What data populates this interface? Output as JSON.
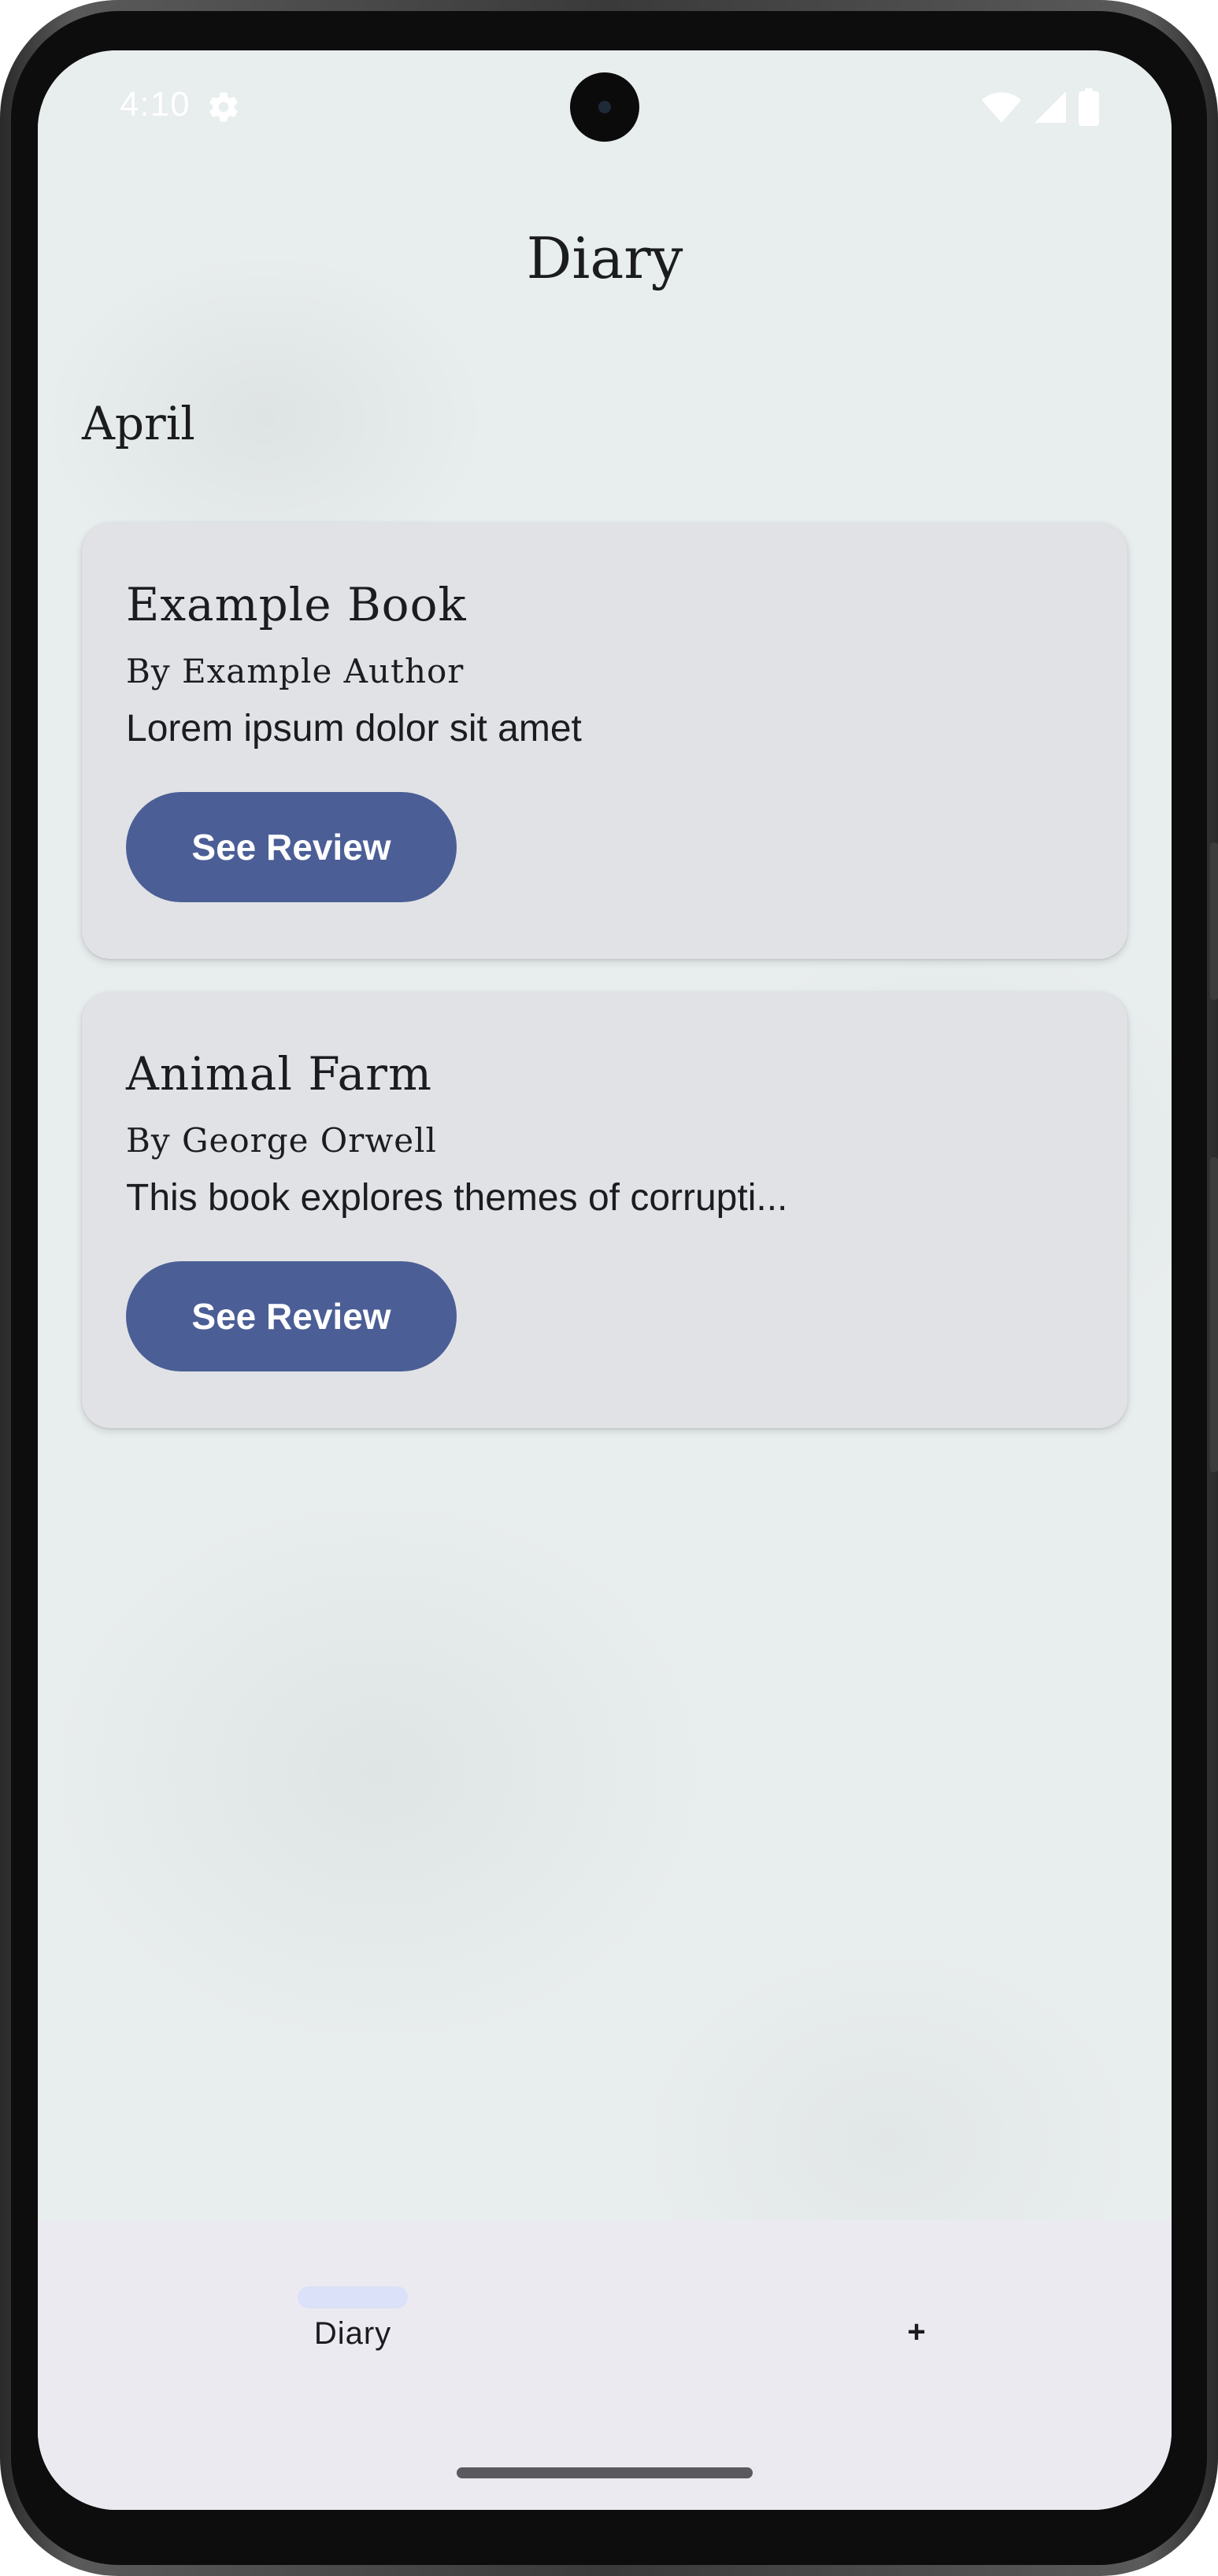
{
  "status_bar": {
    "time": "4:10",
    "settings_icon": "gear-icon",
    "wifi_icon": "wifi-icon",
    "signal_icon": "cellular-signal-icon",
    "battery_icon": "battery-icon"
  },
  "header": {
    "title": "Diary"
  },
  "main": {
    "month": "April",
    "entries": [
      {
        "title": "Example Book",
        "author": "By Example Author",
        "excerpt": "Lorem ipsum dolor sit amet",
        "button_label": "See Review"
      },
      {
        "title": "Animal Farm",
        "author": "By George Orwell",
        "excerpt": "This book explores themes of corrupti...",
        "button_label": "See Review"
      }
    ]
  },
  "bottom_nav": {
    "items": [
      {
        "label": "Diary",
        "active": true
      },
      {
        "label": "+",
        "active": false
      }
    ]
  },
  "colors": {
    "accent": "#4b5e96",
    "card_bg": "#e1e2e6",
    "nav_bg": "#eceaf1",
    "nav_indicator": "#dae1f8",
    "screen_bg": "#e8eded"
  }
}
